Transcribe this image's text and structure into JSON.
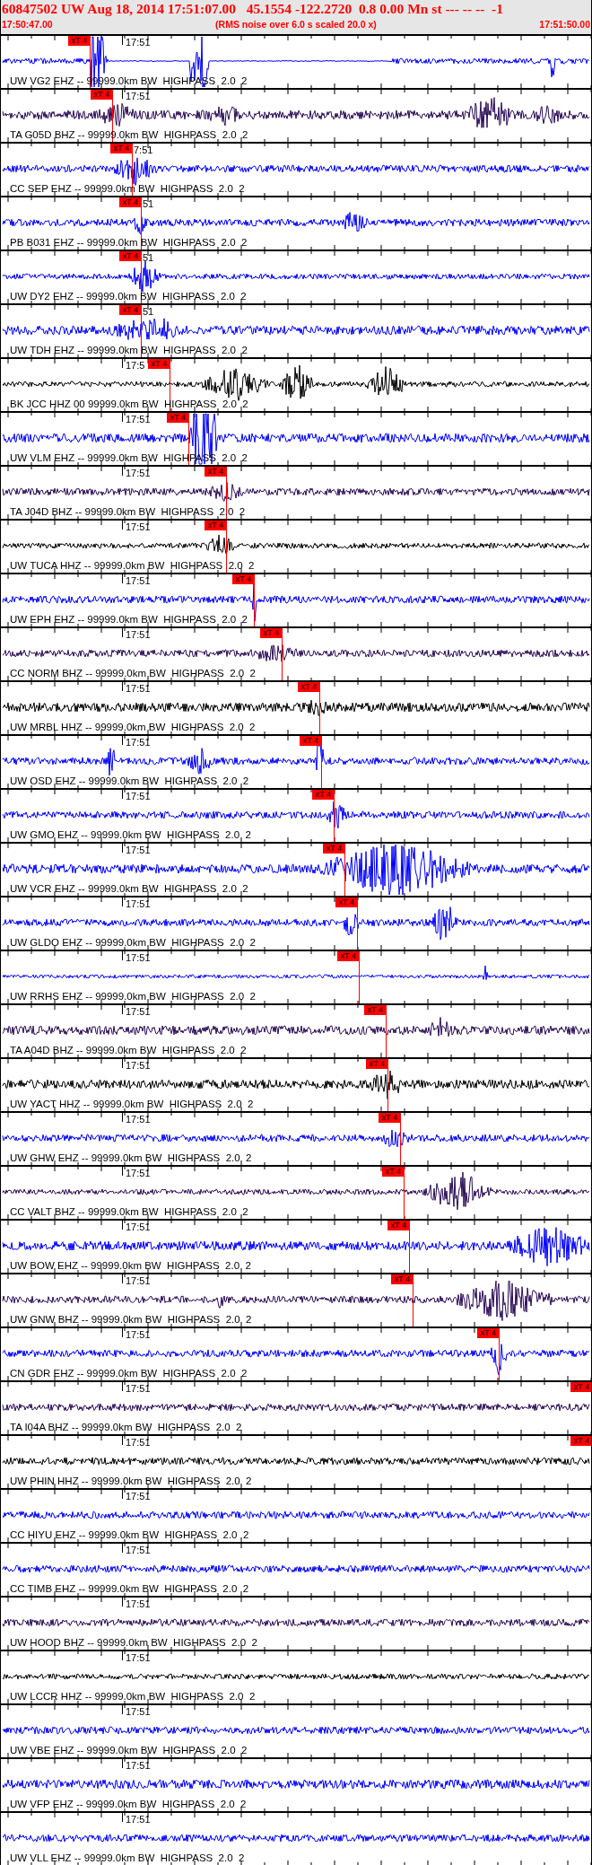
{
  "header": {
    "title": "60847502 UW Aug 18, 2014 17:51:07.00   45.1554 -122.2720  0.8 0.00 Mn st --- -- --  -1",
    "start_time": "17:50:47.00",
    "caption": "(RMS noise over 6.0 s scaled 20.0 x)",
    "end_time": "17:51:50.00"
  },
  "traces": [
    {
      "label": "UW VG2 EHZ -- 99999.0km BW  HIGHPASS  2.0  2",
      "time_label": "17:51",
      "color": "#0000ff",
      "pick": "xT 4"
    },
    {
      "label": "TA G05D BHZ -- 99999.0km BW  HIGHPASS  2.0  2",
      "time_label": "17:51",
      "color": "#2a0a55",
      "pick": "xT 4"
    },
    {
      "label": "CC SEP EHZ -- 99999.0km BW  HIGHPASS  2.0  2",
      "time_label": "7:51",
      "color": "#0000ff",
      "pick": "xT 4"
    },
    {
      "label": "PB B031 EHZ -- 99999.0km BW  HIGHPASS  2.0  2",
      "time_label": "51",
      "color": "#0000ff",
      "pick": "xT 4"
    },
    {
      "label": "UW DY2 EHZ -- 99999.0km BW  HIGHPASS  2.0  2",
      "time_label": "51",
      "color": "#0000ff",
      "pick": "xT 4"
    },
    {
      "label": "UW TDH EHZ -- 99999.0km BW  HIGHPASS  2.0  2",
      "time_label": "51",
      "color": "#0000ff",
      "pick": "xT 4"
    },
    {
      "label": "BK JCC HHZ 00 99999.0km BW  HIGHPASS  2.0  2",
      "time_label": "17:5",
      "color": "#000000",
      "pick": "xT 4"
    },
    {
      "label": "UW VLM EHZ -- 99999.0km BW  HIGHPASS  2.0  2",
      "time_label": "17:51",
      "color": "#0000ff",
      "pick": "xT 4"
    },
    {
      "label": "TA J04D BHZ -- 99999.0km BW  HIGHPASS  2.0  2",
      "time_label": "17:51",
      "color": "#2a0a55",
      "pick": "xT 4"
    },
    {
      "label": "UW TUCA HHZ -- 99999.0km BW  HIGHPASS  2.0  2",
      "time_label": "17:51",
      "color": "#000000",
      "pick": "xT 4"
    },
    {
      "label": "UW EPH EHZ -- 99999.0km BW  HIGHPASS  2.0  2",
      "time_label": "17:51",
      "color": "#0000ff",
      "pick": "xT 4"
    },
    {
      "label": "CC NORM BHZ -- 99999.0km BW  HIGHPASS  2.0  2",
      "time_label": "17:51",
      "color": "#2a0a55",
      "pick": "xT 4"
    },
    {
      "label": "UW MRBL HHZ -- 99999.0km BW  HIGHPASS  2.0  2",
      "time_label": "17:51",
      "color": "#000000",
      "pick": "xT 4"
    },
    {
      "label": "UW OSD EHZ -- 99999.0km BW  HIGHPASS  2.0  2",
      "time_label": "17:51",
      "color": "#0000ff",
      "pick": "xT 4"
    },
    {
      "label": "UW GMO EHZ -- 99999.0km BW  HIGHPASS  2.0  2",
      "time_label": "17:51",
      "color": "#0000ff",
      "pick": "xT 4"
    },
    {
      "label": "UW VCR EHZ -- 99999.0km BW  HIGHPASS  2.0  2",
      "time_label": "17:51",
      "color": "#0000ff",
      "pick": "xT 4"
    },
    {
      "label": "UW GLDO EHZ -- 99999.0km BW  HIGHPASS  2.0  2",
      "time_label": "17:51",
      "color": "#0000ff",
      "pick": "xT 4"
    },
    {
      "label": "UW RRHS EHZ -- 99999.0km BW  HIGHPASS  2.0  2",
      "time_label": "17:51",
      "color": "#0000ff",
      "pick": "xT 4"
    },
    {
      "label": "TA A04D BHZ -- 99999.0km BW  HIGHPASS  2.0  2",
      "time_label": "17:51",
      "color": "#2a0a55",
      "pick": "xT 4"
    },
    {
      "label": "UW YACT HHZ -- 99999.0km BW  HIGHPASS  2.0  2",
      "time_label": "17:51",
      "color": "#000000",
      "pick": "xT 4"
    },
    {
      "label": "UW GHW EHZ -- 99999.0km BW  HIGHPASS  2.0  2",
      "time_label": "17:51",
      "color": "#0000ff",
      "pick": "xT 4"
    },
    {
      "label": "CC VALT BHZ -- 99999.0km BW  HIGHPASS  2.0  2",
      "time_label": "17:51",
      "color": "#2a0a55",
      "pick": "xT 4"
    },
    {
      "label": "UW BOW EHZ -- 99999.0km BW  HIGHPASS  2.0  2",
      "time_label": "17:51",
      "color": "#0000ff",
      "pick": "xT 4"
    },
    {
      "label": "UW GNW BHZ -- 99999.0km BW  HIGHPASS  2.0  2",
      "time_label": "17:51",
      "color": "#2a0a55",
      "pick": "xT 4"
    },
    {
      "label": "CN GDR EHZ -- 99999.0km BW  HIGHPASS  2.0  2",
      "time_label": "17:51",
      "color": "#0000ff",
      "pick": "xT 4"
    },
    {
      "label": "TA I04A BHZ -- 99999.0km BW  HIGHPASS  2.0  2",
      "time_label": "17:51",
      "color": "#2a0a55",
      "pick": "xT 4"
    },
    {
      "label": "UW PHIN HHZ -- 99999.0km BW  HIGHPASS  2.0  2",
      "time_label": "17:51",
      "color": "#000000",
      "pick": "xT 4"
    },
    {
      "label": "CC HIYU EHZ -- 99999.0km BW  HIGHPASS  2.0  2",
      "time_label": "17:51",
      "color": "#0000ff"
    },
    {
      "label": "CC TIMB EHZ -- 99999.0km BW  HIGHPASS  2.0  2",
      "time_label": "17:51",
      "color": "#0000ff"
    },
    {
      "label": "UW HOOD BHZ -- 99999.0km BW  HIGHPASS  2.0  2",
      "time_label": "17:51",
      "color": "#2a0a55"
    },
    {
      "label": "UW LCCR HHZ -- 99999.0km BW  HIGHPASS  2.0  2",
      "time_label": "17:51",
      "color": "#000000"
    },
    {
      "label": "UW VBE EHZ -- 99999.0km BW  HIGHPASS  2.0  2",
      "time_label": "17:51",
      "color": "#0000ff"
    },
    {
      "label": "UW VFP EHZ -- 99999.0km BW  HIGHPASS  2.0  2",
      "time_label": "17:51",
      "color": "#0000ff"
    },
    {
      "label": "UW VLL EHZ -- 99999.0km BW  HIGHPASS  2.0  2",
      "time_label": "17:51",
      "color": "#0000ff"
    }
  ]
}
